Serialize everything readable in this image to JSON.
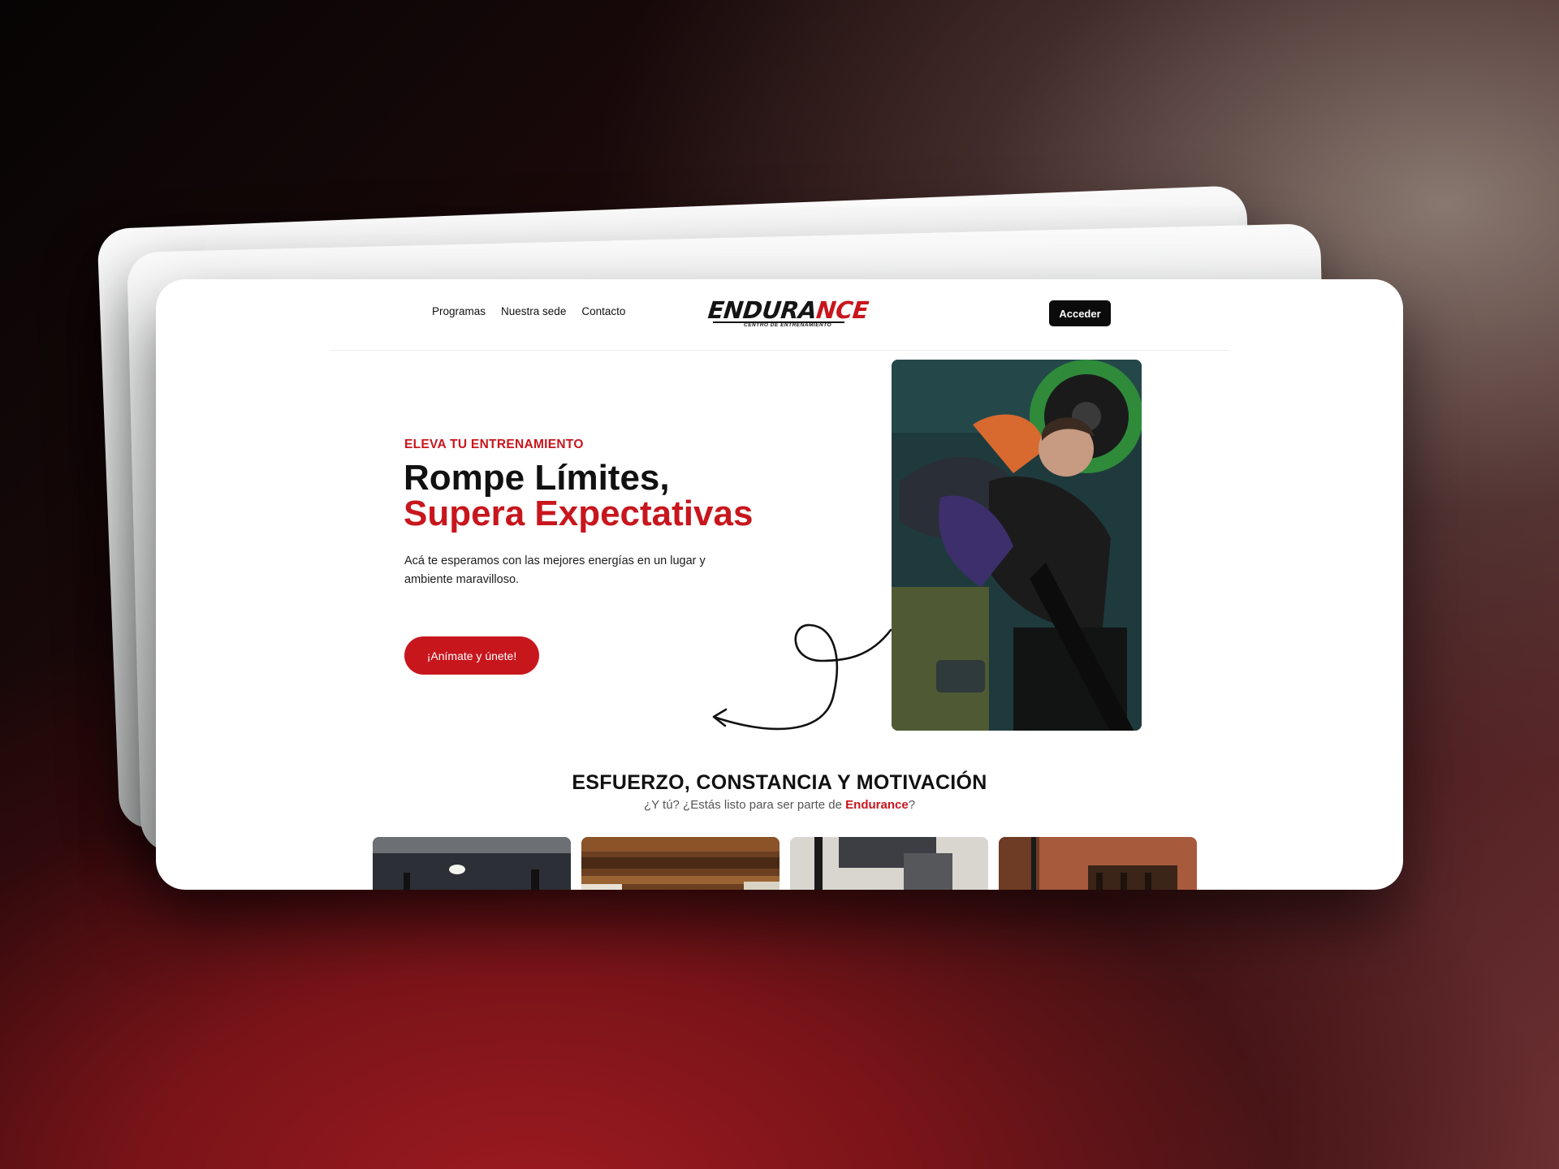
{
  "brand": {
    "logo_main": "ENDURA",
    "logo_accent": "NCE",
    "logo_tagline": "CENTRO DE ENTRENAMIENTO"
  },
  "nav": {
    "links": [
      "Programas",
      "Nuestra sede",
      "Contacto"
    ],
    "login_label": "Acceder"
  },
  "hero": {
    "eyebrow": "ELEVA TU ENTRENAMIENTO",
    "title_line1": "Rompe Límites,",
    "title_line2": "Supera Expectativas",
    "description": "Acá te esperamos con las mejores energías en un lugar y ambiente maravilloso.",
    "cta_label": "¡Anímate y únete!"
  },
  "section": {
    "title": "ESFUERZO, CONSTANCIA Y MOTIVACIÓN",
    "subtitle_before": "¿Y tú? ¿Estás listo para ser parte de ",
    "subtitle_brand": "Endurance",
    "subtitle_after": "?"
  },
  "colors": {
    "accent": "#c8161d",
    "dark": "#0b0b0b"
  }
}
